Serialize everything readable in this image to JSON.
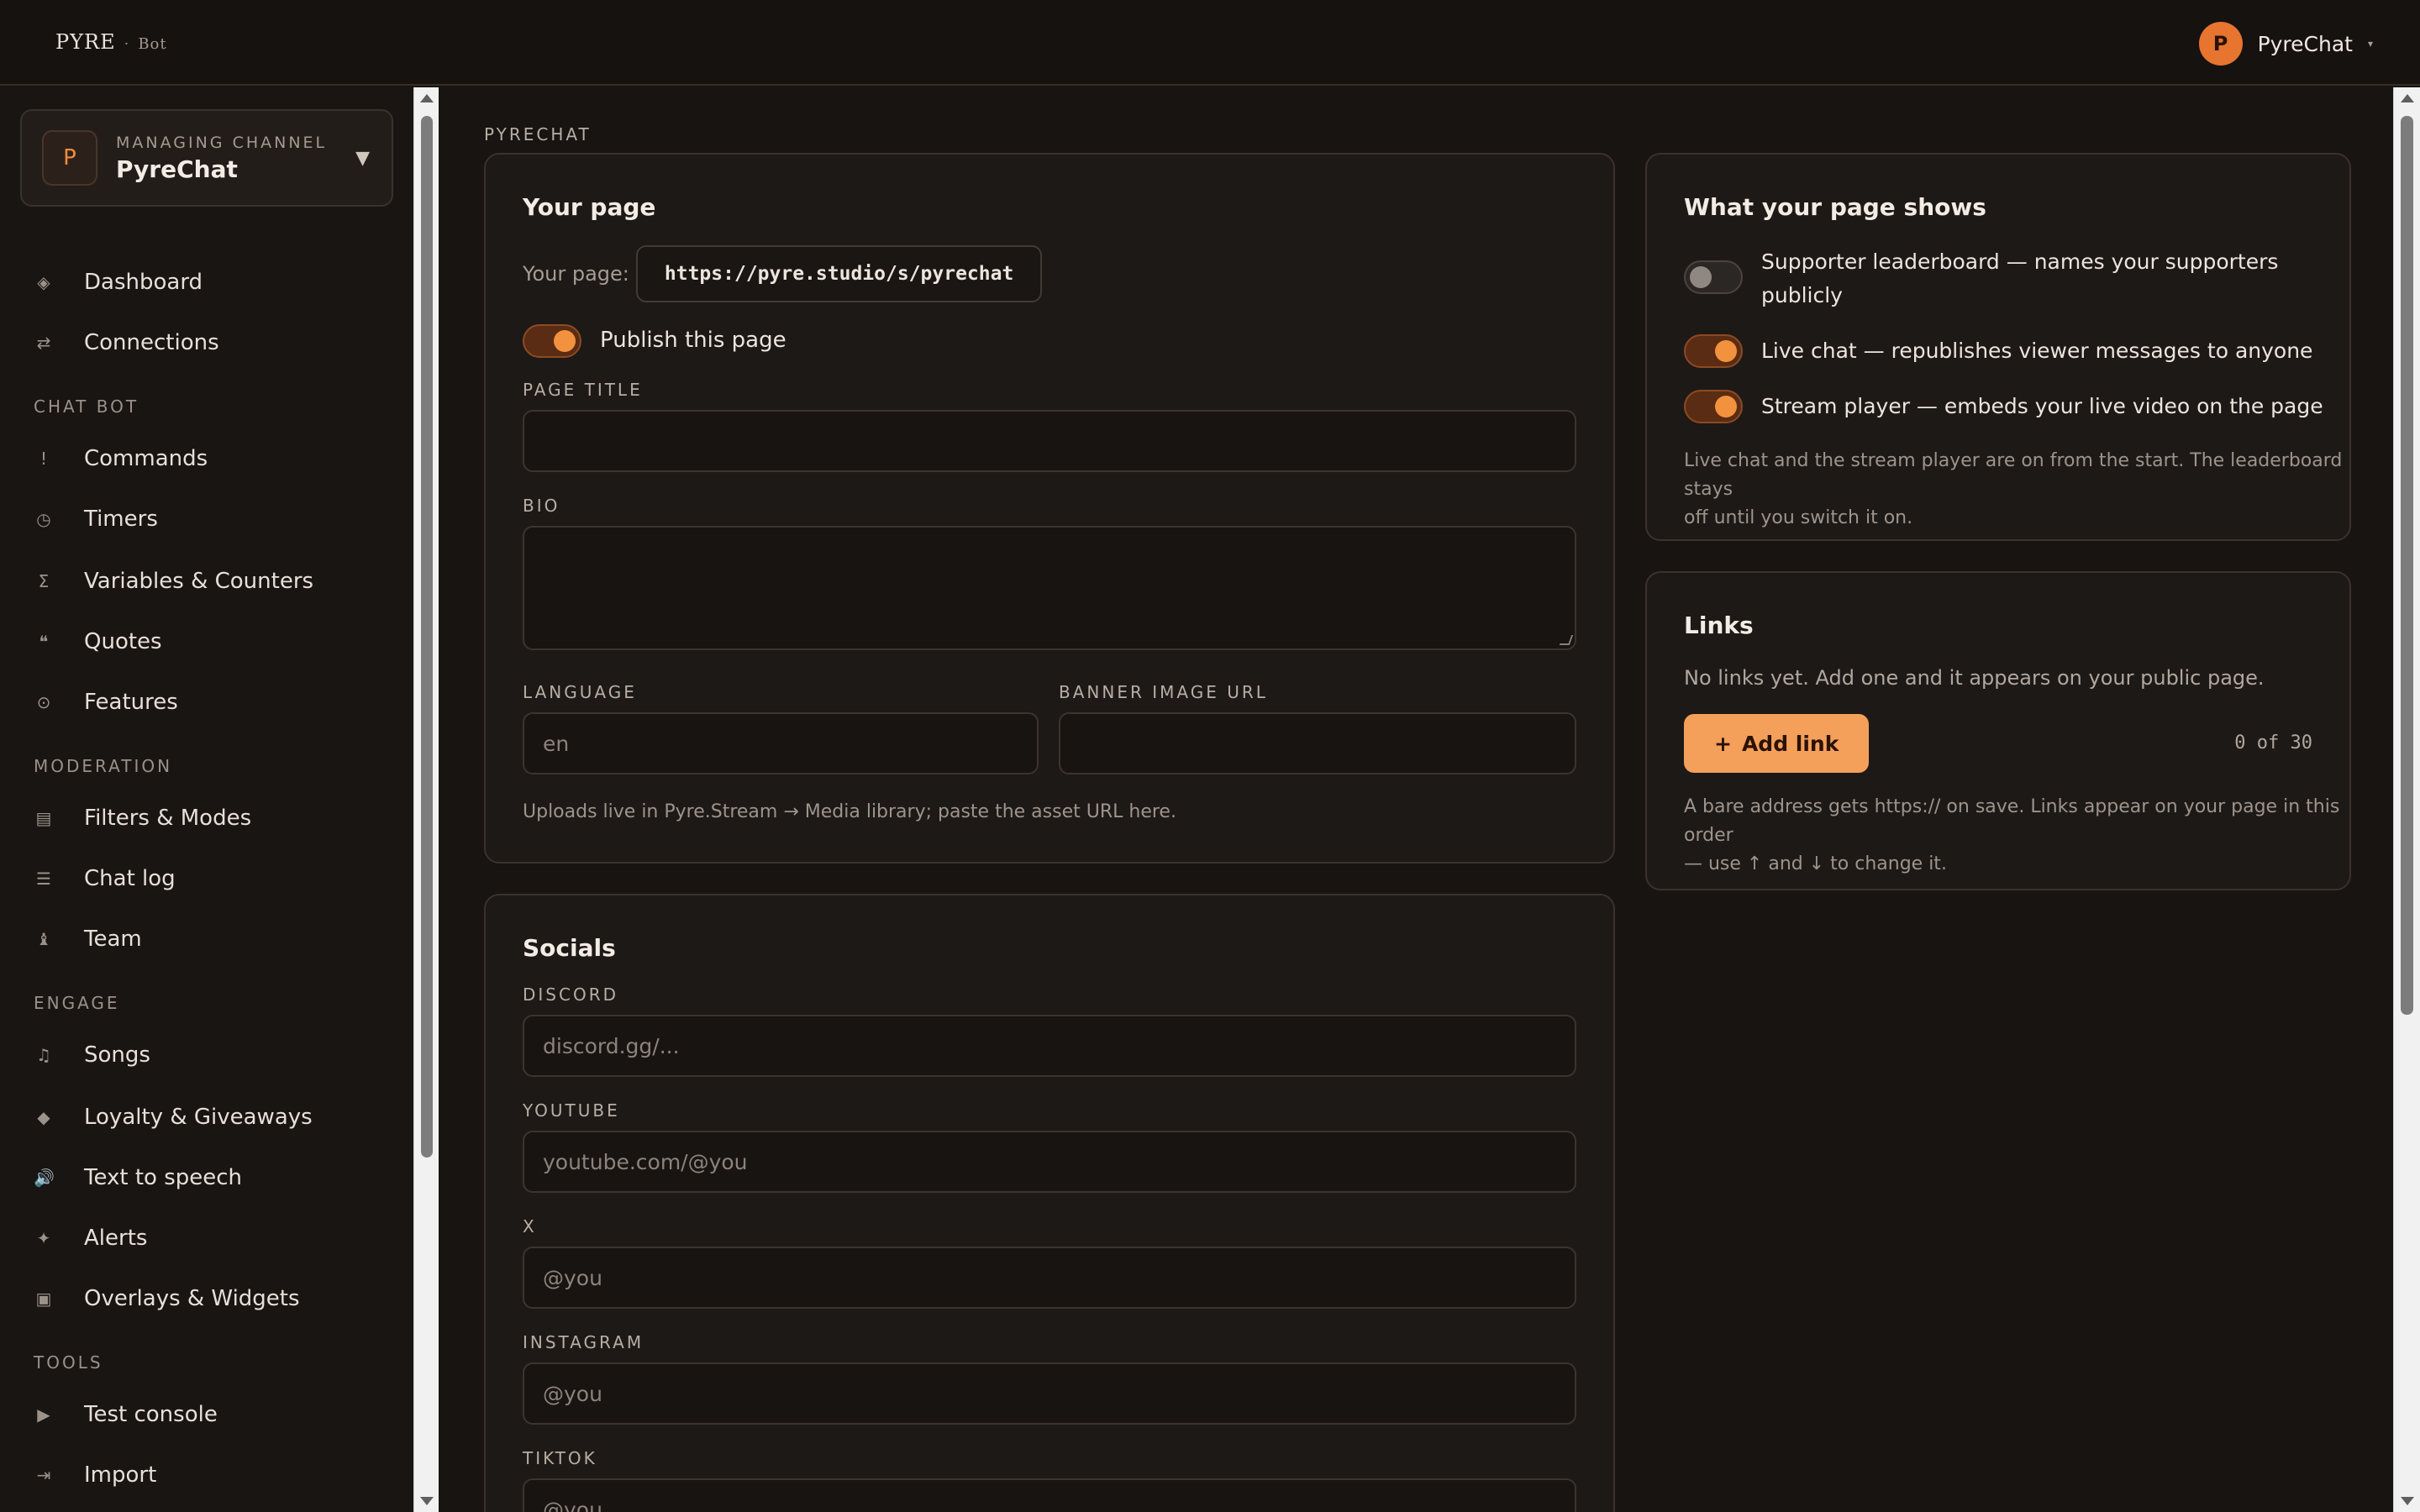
{
  "header": {
    "logo_text": "PYRE",
    "logo_sep": "·",
    "logo_sub": "Bot",
    "user_initial": "P",
    "user_name": "PyreChat"
  },
  "sidebar": {
    "channel": {
      "initial": "P",
      "label": "MANAGING CHANNEL",
      "name": "PyreChat"
    },
    "items_top": [
      {
        "label": "Dashboard",
        "icon": "◈"
      },
      {
        "label": "Connections",
        "icon": "⇄"
      }
    ],
    "section_chatbot": "CHAT BOT",
    "items_chatbot": [
      {
        "label": "Commands",
        "icon": "!"
      },
      {
        "label": "Timers",
        "icon": "◷"
      },
      {
        "label": "Variables & Counters",
        "icon": "Σ"
      },
      {
        "label": "Quotes",
        "icon": "❝"
      },
      {
        "label": "Features",
        "icon": "⊙"
      }
    ],
    "section_moderation": "MODERATION",
    "items_moderation": [
      {
        "label": "Filters & Modes",
        "icon": "▤"
      },
      {
        "label": "Chat log",
        "icon": "☰"
      },
      {
        "label": "Team",
        "icon": "♝"
      }
    ],
    "section_engage": "ENGAGE",
    "items_engage": [
      {
        "label": "Songs",
        "icon": "♫"
      },
      {
        "label": "Loyalty & Giveaways",
        "icon": "◆"
      },
      {
        "label": "Text to speech",
        "icon": "🔊"
      },
      {
        "label": "Alerts",
        "icon": "✦"
      },
      {
        "label": "Overlays & Widgets",
        "icon": "▣"
      }
    ],
    "section_tools": "TOOLS",
    "items_tools": [
      {
        "label": "Test console",
        "icon": "▶"
      },
      {
        "label": "Import",
        "icon": "⇥"
      }
    ]
  },
  "main": {
    "breadcrumb": "PYRECHAT",
    "your_page": {
      "title": "Your page",
      "url_label": "Your page:",
      "url": "https://pyre.studio/s/pyrechat",
      "publish_label": "Publish this page",
      "publish_on": true,
      "page_title_label": "PAGE TITLE",
      "page_title_value": "",
      "bio_label": "BIO",
      "language_label": "LANGUAGE",
      "language_placeholder": "en",
      "banner_label": "BANNER IMAGE URL",
      "banner_value": "",
      "helper": "Uploads live in Pyre.Stream → Media library; paste the asset URL here."
    },
    "socials": {
      "title": "Socials",
      "fields": [
        {
          "label": "DISCORD",
          "placeholder": "discord.gg/..."
        },
        {
          "label": "YOUTUBE",
          "placeholder": "youtube.com/@you"
        },
        {
          "label": "X",
          "placeholder": "@you"
        },
        {
          "label": "INSTAGRAM",
          "placeholder": "@you"
        },
        {
          "label": "TIKTOK",
          "placeholder": "@you"
        }
      ]
    },
    "page_shows": {
      "title": "What your page shows",
      "options": [
        {
          "label_line1": "Supporter leaderboard — names your supporters",
          "label_line2": "publicly",
          "on": false
        },
        {
          "label_line1": "Live chat — republishes viewer messages to anyone",
          "label_line2": "",
          "on": true
        },
        {
          "label_line1": "Stream player — embeds your live video on the page",
          "label_line2": "",
          "on": true
        }
      ],
      "helper_line1": "Live chat and the stream player are on from the start. The leaderboard stays",
      "helper_line2": "off until you switch it on."
    },
    "links": {
      "title": "Links",
      "empty_text": "No links yet. Add one and it appears on your public page.",
      "add_label": "Add link",
      "add_icon": "+",
      "count": "0 of 30",
      "helper_line1": "A bare address gets https:// on save. Links appear on your page in this order",
      "helper_line2": "— use ↑ and ↓ to change it."
    }
  },
  "colors": {
    "accent": "#f4a05a",
    "accent_strong": "#e7742f",
    "background": "#171412",
    "card": "#1d1917"
  }
}
